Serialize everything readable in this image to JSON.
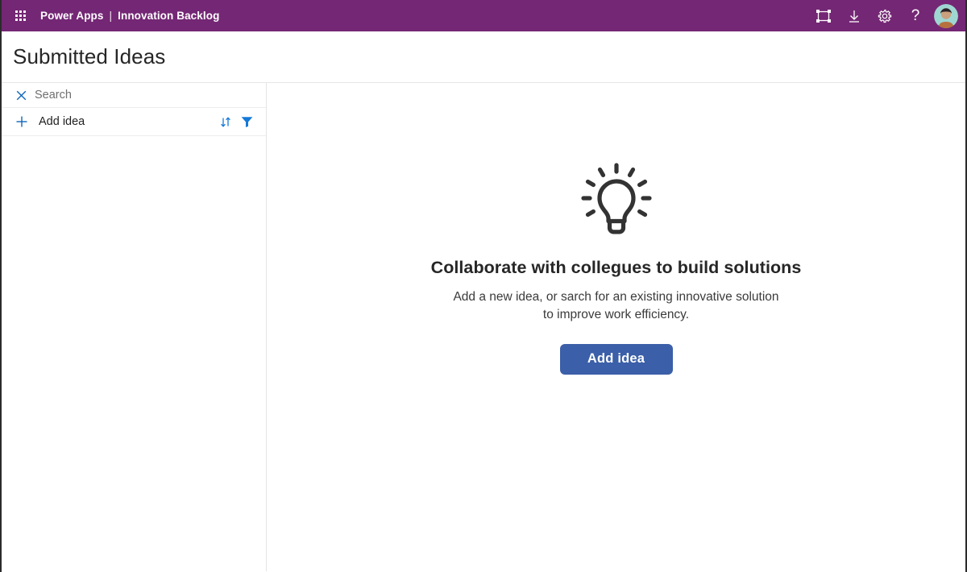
{
  "topbar": {
    "waffle_icon": "app-launcher-waffle-icon",
    "product": "Power Apps",
    "separator": "|",
    "app_name": "Innovation Backlog",
    "icons": [
      {
        "name": "fit-to-screen-icon",
        "label": "Fit to screen"
      },
      {
        "name": "download-icon",
        "label": "Download"
      },
      {
        "name": "gear-icon",
        "label": "Settings"
      },
      {
        "name": "help-icon",
        "label": "?"
      }
    ],
    "avatar_label": "Account manager"
  },
  "page": {
    "title": "Submitted Ideas"
  },
  "gallery": {
    "search": {
      "placeholder": "Search",
      "value": "",
      "clear_icon": "close-x-icon"
    },
    "add_row": {
      "plus_icon": "plus-icon",
      "label": "Add idea",
      "sort_icon": "sort-arrows-icon",
      "filter_icon": "filter-funnel-icon"
    },
    "items": []
  },
  "empty_state": {
    "illustration_icon": "lightbulb-icon",
    "heading": "Collaborate with collegues to build solutions",
    "subtext": "Add a new idea, or sarch for an existing innovative solution to improve work efficiency.",
    "button_label": "Add idea"
  },
  "colors": {
    "brand_purple": "#742774",
    "accent_blue": "#1267b8",
    "button_blue": "#3b5fa8",
    "text_dark": "#262626",
    "text_muted": "#6f6f6f"
  }
}
